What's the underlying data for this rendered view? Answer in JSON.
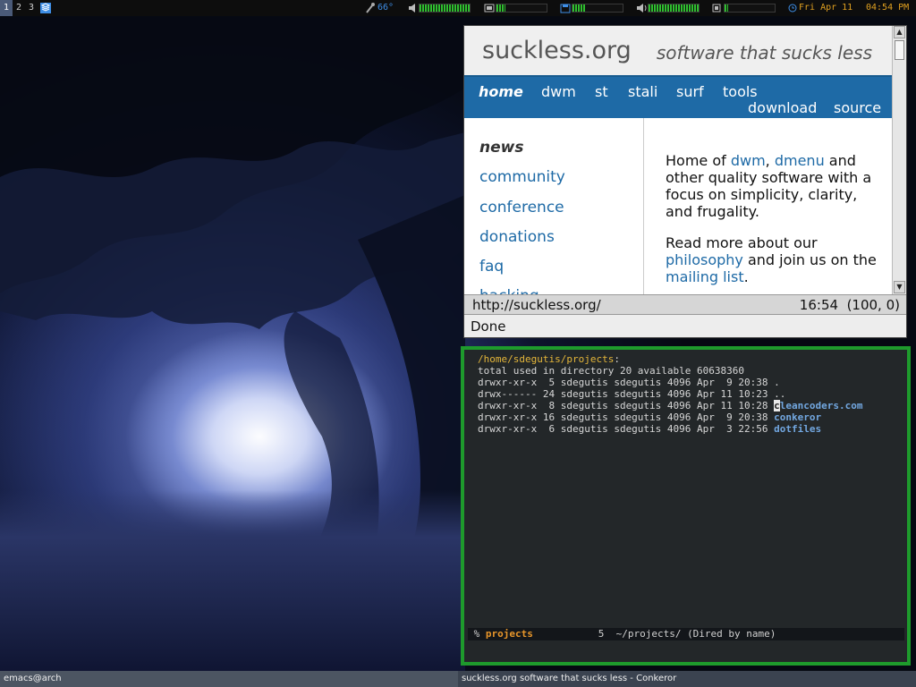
{
  "topbar": {
    "workspaces": [
      "1",
      "2",
      "3"
    ],
    "active_workspace": "1",
    "temperature": "66°",
    "volume_level": 1.0,
    "meter_levels": [
      0.18,
      0.25,
      1.0,
      0.07
    ],
    "date": "Fri Apr 11",
    "time": "04:54 PM",
    "colors": {
      "accent": "#3e8ee6",
      "meter": "#2fbf2f",
      "clock": "#e0a020"
    }
  },
  "browser": {
    "site_logo": "suckless.org",
    "tagline": "software that sucks less",
    "nav": [
      "home",
      "dwm",
      "st",
      "stali",
      "surf",
      "tools",
      "download",
      "source"
    ],
    "current_nav": "home",
    "sidebar": [
      "news",
      "community",
      "conference",
      "donations",
      "faq",
      "hacking"
    ],
    "current_sidebar": "news",
    "intro": {
      "t1": "Home of ",
      "l1": "dwm",
      "t2": ", ",
      "l2": "dmenu",
      "t3": " and other quality software with a focus on simplicity, clarity, and frugality."
    },
    "more": {
      "t1": "Read more about our ",
      "l1": "philosophy",
      "t2": " and join us on the ",
      "l2": "mailing list",
      "t3": "."
    },
    "url": "http://suckless.org/",
    "status_time": "16:54",
    "status_pos": "(100, 0)",
    "minibuffer": "Done",
    "colors": {
      "nav_bg": "#1e6aa6",
      "link": "#1e6aa6"
    }
  },
  "emacs": {
    "dir": "/home/sdegutis/projects",
    "total_line": "total used in directory 20 available 60638360",
    "rows": [
      {
        "perms": "drwxr-xr-x",
        "links": "5",
        "owner": "sdegutis",
        "group": "sdegutis",
        "size": "4096",
        "date": "Apr  9 20:38",
        "name": "."
      },
      {
        "perms": "drwx------",
        "links": "24",
        "owner": "sdegutis",
        "group": "sdegutis",
        "size": "4096",
        "date": "Apr 11 10:23",
        "name": ".."
      },
      {
        "perms": "drwxr-xr-x",
        "links": "8",
        "owner": "sdegutis",
        "group": "sdegutis",
        "size": "4096",
        "date": "Apr 11 10:28",
        "name": "cleancoders.com"
      },
      {
        "perms": "drwxr-xr-x",
        "links": "16",
        "owner": "sdegutis",
        "group": "sdegutis",
        "size": "4096",
        "date": "Apr  9 20:38",
        "name": "conkeror"
      },
      {
        "perms": "drwxr-xr-x",
        "links": "6",
        "owner": "sdegutis",
        "group": "sdegutis",
        "size": "4096",
        "date": "Apr  3 22:56",
        "name": "dotfiles"
      }
    ],
    "modeline": {
      "flag": "%",
      "buffer": "projects",
      "line": "5",
      "rest": "~/projects/ (Dired by name)"
    },
    "colors": {
      "border": "#1e9a2c",
      "dir": "#e4b63a",
      "file": "#72a7e0"
    }
  },
  "bottombar": {
    "left_title": "emacs@arch",
    "right_title": "suckless.org software that sucks less - Conkeror"
  }
}
